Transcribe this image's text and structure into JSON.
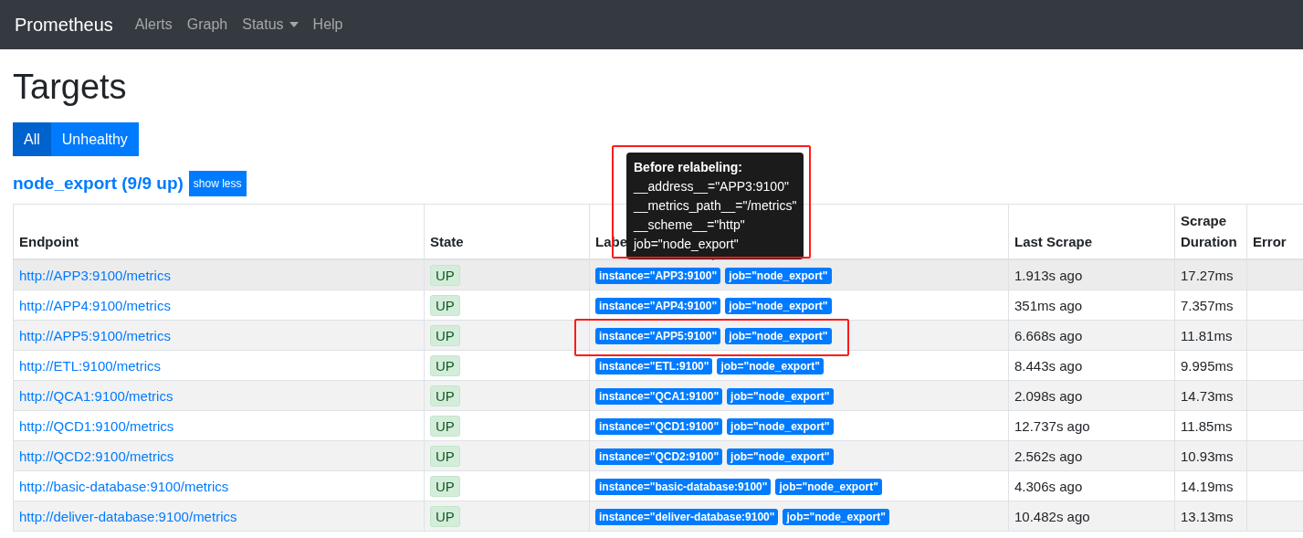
{
  "navbar": {
    "brand": "Prometheus",
    "items": [
      {
        "label": "Alerts",
        "kind": "link"
      },
      {
        "label": "Graph",
        "kind": "link"
      },
      {
        "label": "Status",
        "kind": "dropdown"
      },
      {
        "label": "Help",
        "kind": "link"
      }
    ]
  },
  "title": "Targets",
  "filters": [
    {
      "label": "All",
      "selected": true
    },
    {
      "label": "Unhealthy",
      "selected": false
    }
  ],
  "group": {
    "heading": "node_export (9/9 up)",
    "toggle": "show less"
  },
  "table": {
    "columns": [
      "Endpoint",
      "State",
      "Labe",
      "Last Scrape",
      "Scrape Duration",
      "Error"
    ],
    "rows": [
      {
        "endpoint": "http://APP3:9100/metrics",
        "state": "UP",
        "labels": [
          "instance=\"APP3:9100\"",
          "job=\"node_export\""
        ],
        "last_scrape": "1.913s ago",
        "duration": "17.27ms",
        "hovered": true,
        "highlighted": false
      },
      {
        "endpoint": "http://APP4:9100/metrics",
        "state": "UP",
        "labels": [
          "instance=\"APP4:9100\"",
          "job=\"node_export\""
        ],
        "last_scrape": "351ms ago",
        "duration": "7.357ms",
        "hovered": false,
        "highlighted": false
      },
      {
        "endpoint": "http://APP5:9100/metrics",
        "state": "UP",
        "labels": [
          "instance=\"APP5:9100\"",
          "job=\"node_export\""
        ],
        "last_scrape": "6.668s ago",
        "duration": "11.81ms",
        "hovered": false,
        "highlighted": true
      },
      {
        "endpoint": "http://ETL:9100/metrics",
        "state": "UP",
        "labels": [
          "instance=\"ETL:9100\"",
          "job=\"node_export\""
        ],
        "last_scrape": "8.443s ago",
        "duration": "9.995ms",
        "hovered": false,
        "highlighted": false
      },
      {
        "endpoint": "http://QCA1:9100/metrics",
        "state": "UP",
        "labels": [
          "instance=\"QCA1:9100\"",
          "job=\"node_export\""
        ],
        "last_scrape": "2.098s ago",
        "duration": "14.73ms",
        "hovered": false,
        "highlighted": false
      },
      {
        "endpoint": "http://QCD1:9100/metrics",
        "state": "UP",
        "labels": [
          "instance=\"QCD1:9100\"",
          "job=\"node_export\""
        ],
        "last_scrape": "12.737s ago",
        "duration": "11.85ms",
        "hovered": false,
        "highlighted": false
      },
      {
        "endpoint": "http://QCD2:9100/metrics",
        "state": "UP",
        "labels": [
          "instance=\"QCD2:9100\"",
          "job=\"node_export\""
        ],
        "last_scrape": "2.562s ago",
        "duration": "10.93ms",
        "hovered": false,
        "highlighted": false
      },
      {
        "endpoint": "http://basic-database:9100/metrics",
        "state": "UP",
        "labels": [
          "instance=\"basic-database:9100\"",
          "job=\"node_export\""
        ],
        "last_scrape": "4.306s ago",
        "duration": "14.19ms",
        "hovered": false,
        "highlighted": false
      },
      {
        "endpoint": "http://deliver-database:9100/metrics",
        "state": "UP",
        "labels": [
          "instance=\"deliver-database:9100\"",
          "job=\"node_export\""
        ],
        "last_scrape": "10.482s ago",
        "duration": "13.13ms",
        "hovered": false,
        "highlighted": false
      }
    ]
  },
  "tooltip": {
    "heading": "Before relabeling:",
    "lines": [
      "__address__=\"APP3:9100\"",
      "__metrics_path__=\"/metrics\"",
      "__scheme__=\"http\"",
      "job=\"node_export\""
    ],
    "highlighted": true
  }
}
